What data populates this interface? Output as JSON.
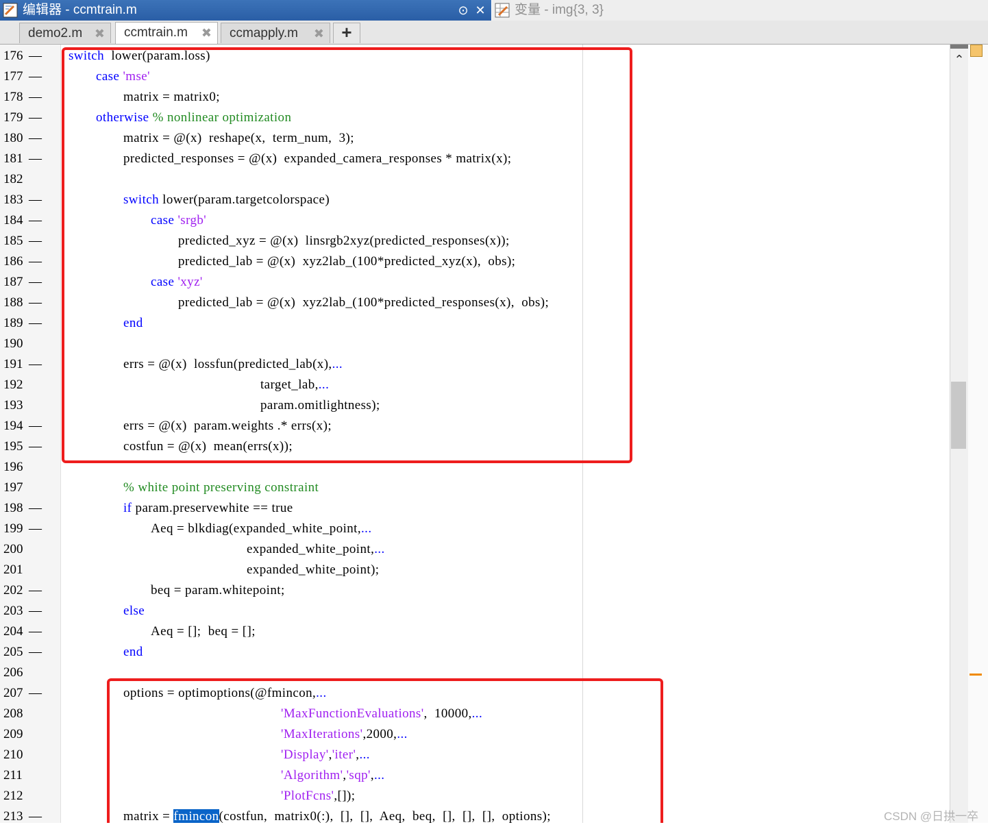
{
  "window": {
    "editor_title": "编辑器 - ccmtrain.m",
    "variables_title": "变量 - img{3, 3}",
    "dropdown_glyph": "⊙",
    "close_glyph": "✕"
  },
  "tabs": [
    {
      "label": "demo2.m",
      "close": "✖"
    },
    {
      "label": "ccmtrain.m",
      "close": "✖"
    },
    {
      "label": "ccmapply.m",
      "close": "✖"
    }
  ],
  "tab_add": "+",
  "lines": [
    {
      "n": "176",
      "dash": true,
      "indent": 0,
      "tokens": [
        [
          "kw",
          "switch"
        ],
        [
          "",
          "  lower(param.loss)"
        ]
      ]
    },
    {
      "n": "177",
      "dash": true,
      "indent": 4,
      "tokens": [
        [
          "kw",
          "case"
        ],
        [
          "",
          " "
        ],
        [
          "str",
          "'mse'"
        ]
      ]
    },
    {
      "n": "178",
      "dash": true,
      "indent": 8,
      "tokens": [
        [
          "",
          "matrix = matrix0;"
        ]
      ]
    },
    {
      "n": "179",
      "dash": true,
      "indent": 4,
      "tokens": [
        [
          "kw",
          "otherwise"
        ],
        [
          "",
          " "
        ],
        [
          "cm",
          "% nonlinear optimization"
        ]
      ]
    },
    {
      "n": "180",
      "dash": true,
      "indent": 8,
      "tokens": [
        [
          "",
          "matrix = @(x)  reshape(x,  term_num,  3);"
        ]
      ]
    },
    {
      "n": "181",
      "dash": true,
      "indent": 8,
      "tokens": [
        [
          "",
          "predicted_responses = @(x)  expanded_camera_responses * matrix(x);"
        ]
      ]
    },
    {
      "n": "182",
      "dash": false,
      "indent": 0,
      "tokens": []
    },
    {
      "n": "183",
      "dash": true,
      "indent": 8,
      "tokens": [
        [
          "kw",
          "switch"
        ],
        [
          "",
          " lower(param.targetcolorspace)"
        ]
      ]
    },
    {
      "n": "184",
      "dash": true,
      "indent": 12,
      "tokens": [
        [
          "kw",
          "case"
        ],
        [
          "",
          " "
        ],
        [
          "str",
          "'srgb'"
        ]
      ]
    },
    {
      "n": "185",
      "dash": true,
      "indent": 16,
      "tokens": [
        [
          "",
          "predicted_xyz = @(x)  linsrgb2xyz(predicted_responses(x));"
        ]
      ]
    },
    {
      "n": "186",
      "dash": true,
      "indent": 16,
      "tokens": [
        [
          "",
          "predicted_lab = @(x)  xyz2lab_(100*predicted_xyz(x),  obs);"
        ]
      ]
    },
    {
      "n": "187",
      "dash": true,
      "indent": 12,
      "tokens": [
        [
          "kw",
          "case"
        ],
        [
          "",
          " "
        ],
        [
          "str",
          "'xyz'"
        ]
      ]
    },
    {
      "n": "188",
      "dash": true,
      "indent": 16,
      "tokens": [
        [
          "",
          "predicted_lab = @(x)  xyz2lab_(100*predicted_responses(x),  obs);"
        ]
      ]
    },
    {
      "n": "189",
      "dash": true,
      "indent": 8,
      "tokens": [
        [
          "kw",
          "end"
        ]
      ]
    },
    {
      "n": "190",
      "dash": false,
      "indent": 0,
      "tokens": []
    },
    {
      "n": "191",
      "dash": true,
      "indent": 8,
      "tokens": [
        [
          "",
          "errs = @(x)  lossfun(predicted_lab(x),"
        ],
        [
          "cont",
          "..."
        ]
      ]
    },
    {
      "n": "192",
      "dash": false,
      "indent": 28,
      "tokens": [
        [
          "",
          "target_lab,"
        ],
        [
          "cont",
          "..."
        ]
      ]
    },
    {
      "n": "193",
      "dash": false,
      "indent": 28,
      "tokens": [
        [
          "",
          "param.omitlightness);"
        ]
      ]
    },
    {
      "n": "194",
      "dash": true,
      "indent": 8,
      "tokens": [
        [
          "",
          "errs = @(x)  param.weights .* errs(x);"
        ]
      ]
    },
    {
      "n": "195",
      "dash": true,
      "indent": 8,
      "tokens": [
        [
          "",
          "costfun = @(x)  mean(errs(x));"
        ]
      ]
    },
    {
      "n": "196",
      "dash": false,
      "indent": 0,
      "tokens": []
    },
    {
      "n": "197",
      "dash": false,
      "indent": 8,
      "tokens": [
        [
          "cm",
          "% white point preserving constraint"
        ]
      ]
    },
    {
      "n": "198",
      "dash": true,
      "indent": 8,
      "tokens": [
        [
          "kw",
          "if"
        ],
        [
          "",
          " param.preservewhite == true"
        ]
      ]
    },
    {
      "n": "199",
      "dash": true,
      "indent": 12,
      "tokens": [
        [
          "",
          "Aeq = blkdiag(expanded_white_point,"
        ],
        [
          "cont",
          "..."
        ]
      ]
    },
    {
      "n": "200",
      "dash": false,
      "indent": 26,
      "tokens": [
        [
          "",
          "expanded_white_point,"
        ],
        [
          "cont",
          "..."
        ]
      ]
    },
    {
      "n": "201",
      "dash": false,
      "indent": 26,
      "tokens": [
        [
          "",
          "expanded_white_point);"
        ]
      ]
    },
    {
      "n": "202",
      "dash": true,
      "indent": 12,
      "tokens": [
        [
          "",
          "beq = param.whitepoint;"
        ]
      ]
    },
    {
      "n": "203",
      "dash": true,
      "indent": 8,
      "tokens": [
        [
          "kw",
          "else"
        ]
      ]
    },
    {
      "n": "204",
      "dash": true,
      "indent": 12,
      "tokens": [
        [
          "",
          "Aeq = [];  beq = [];"
        ]
      ]
    },
    {
      "n": "205",
      "dash": true,
      "indent": 8,
      "tokens": [
        [
          "kw",
          "end"
        ]
      ]
    },
    {
      "n": "206",
      "dash": false,
      "indent": 0,
      "tokens": []
    },
    {
      "n": "207",
      "dash": true,
      "indent": 8,
      "tokens": [
        [
          "",
          "options = optimoptions(@fmincon,"
        ],
        [
          "cont",
          "..."
        ]
      ]
    },
    {
      "n": "208",
      "dash": false,
      "indent": 31,
      "tokens": [
        [
          "str",
          "'MaxFunctionEvaluations'"
        ],
        [
          "",
          ",  10000,"
        ],
        [
          "cont",
          "..."
        ]
      ]
    },
    {
      "n": "209",
      "dash": false,
      "indent": 31,
      "tokens": [
        [
          "str",
          "'MaxIterations'"
        ],
        [
          "",
          ",2000,"
        ],
        [
          "cont",
          "..."
        ]
      ]
    },
    {
      "n": "210",
      "dash": false,
      "indent": 31,
      "tokens": [
        [
          "str",
          "'Display'"
        ],
        [
          "",
          ","
        ],
        [
          "str",
          "'iter'"
        ],
        [
          "",
          ","
        ],
        [
          "cont",
          "..."
        ]
      ]
    },
    {
      "n": "211",
      "dash": false,
      "indent": 31,
      "tokens": [
        [
          "str",
          "'Algorithm'"
        ],
        [
          "",
          ","
        ],
        [
          "str",
          "'sqp'"
        ],
        [
          "",
          ","
        ],
        [
          "cont",
          "..."
        ]
      ]
    },
    {
      "n": "212",
      "dash": false,
      "indent": 31,
      "tokens": [
        [
          "str",
          "'PlotFcns'"
        ],
        [
          "",
          ",[]);"
        ]
      ]
    },
    {
      "n": "213",
      "dash": true,
      "indent": 8,
      "tokens": [
        [
          "",
          "matrix = "
        ],
        [
          "sel",
          "fmincon"
        ],
        [
          "",
          "(costfun,  matrix0(:),  [],  [],  Aeq,  beq,  [],  [],  [],  options);"
        ]
      ]
    }
  ],
  "watermark": "CSDN @日拱一卒"
}
